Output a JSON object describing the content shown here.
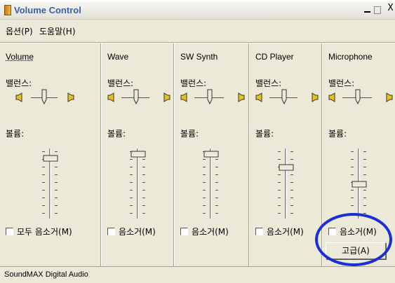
{
  "window": {
    "title": "Volume Control",
    "controls": {
      "minimize": "_",
      "maximize": "□",
      "close": "X"
    }
  },
  "menu": [
    {
      "label": "옵션(P)"
    },
    {
      "label": "도움말(H)"
    }
  ],
  "labels": {
    "balance": "밸런스:",
    "volume": "볼륨:"
  },
  "channels": [
    {
      "name": "Volume",
      "mute_label": "모두 음소거(M)",
      "muted": false,
      "balance": 0,
      "volume": 0.86
    },
    {
      "name": "Wave",
      "mute_label": "음소거(M)",
      "muted": false,
      "balance": 0,
      "volume": 0.92
    },
    {
      "name": "SW Synth",
      "mute_label": "음소거(M)",
      "muted": false,
      "balance": 0,
      "volume": 0.92
    },
    {
      "name": "CD Player",
      "mute_label": "음소거(M)",
      "muted": false,
      "balance": 0,
      "volume": 0.72
    },
    {
      "name": "Microphone",
      "mute_label": "음소거(M)",
      "muted": false,
      "balance": 0,
      "volume": 0.46,
      "advanced_label": "고급(A)"
    }
  ],
  "status": {
    "text": "SoundMAX Digital Audio"
  },
  "colors": {
    "annotation": "#1a2fd4",
    "title_text": "#3b5fa8"
  }
}
